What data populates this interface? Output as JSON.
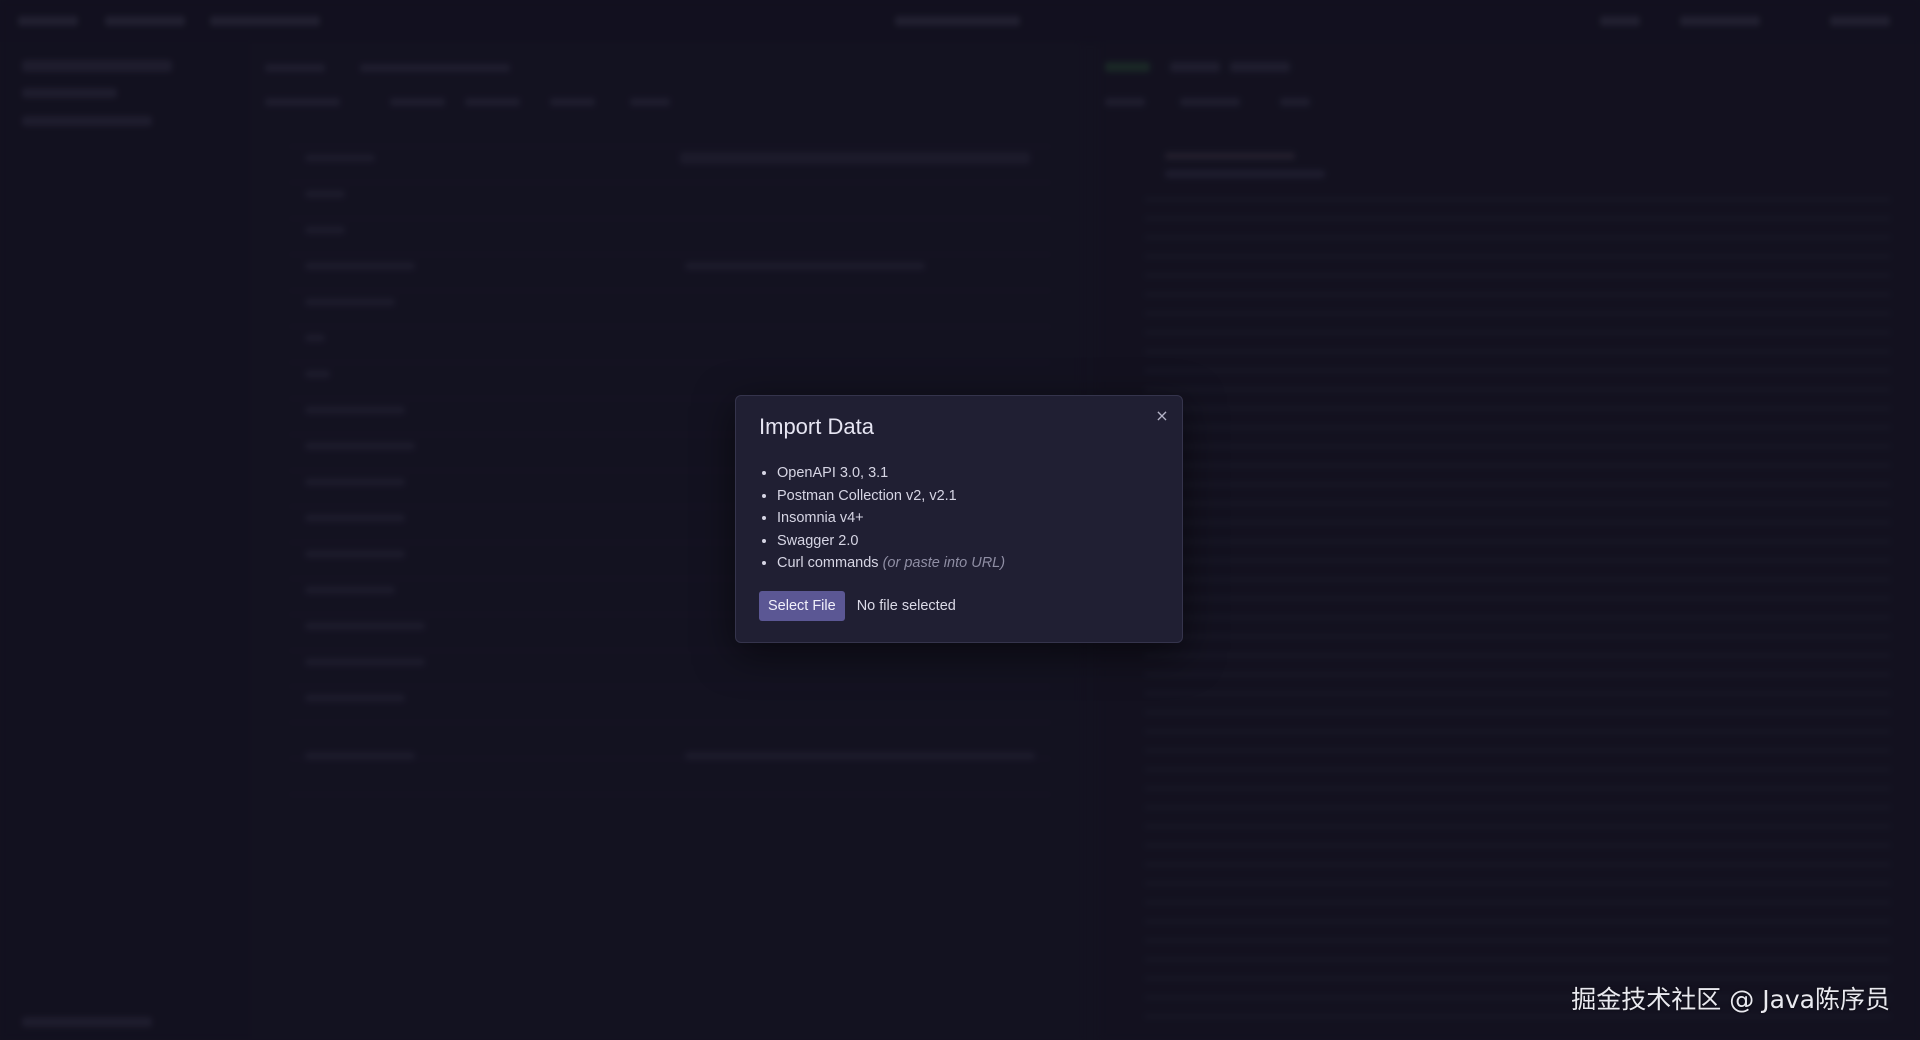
{
  "modal": {
    "title": "Import Data",
    "close_glyph": "×",
    "formats": [
      {
        "label": "OpenAPI 3.0, 3.1",
        "hint": ""
      },
      {
        "label": "Postman Collection v2, v2.1",
        "hint": ""
      },
      {
        "label": "Insomnia v4+",
        "hint": ""
      },
      {
        "label": "Swagger 2.0",
        "hint": ""
      },
      {
        "label": "Curl commands",
        "hint": "(or paste into URL)"
      }
    ],
    "select_file_label": "Select File",
    "file_status": "No file selected"
  },
  "watermark": {
    "text": "掘金技术社区 @ Java陈序员"
  },
  "colors": {
    "backdrop": "#1c1b2d",
    "modal_bg": "#201f33",
    "button_bg": "#5b5794"
  }
}
